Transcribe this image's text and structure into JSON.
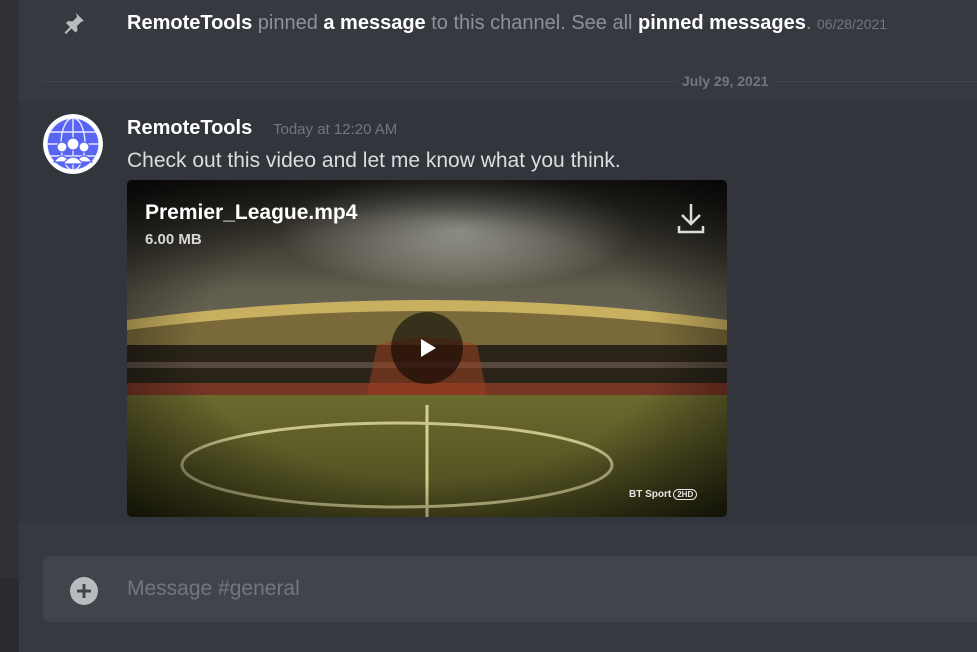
{
  "pinned_notice": {
    "user": "RemoteTools",
    "text_1": " pinned ",
    "link_1": "a message",
    "text_2": " to this channel. See all ",
    "link_2": "pinned messages",
    "text_3": ".",
    "date": "06/28/2021",
    "icon": "pin-icon"
  },
  "divider": {
    "label": "July 29, 2021"
  },
  "message": {
    "author": "RemoteTools",
    "timestamp": "Today at 12:20 AM",
    "content": "Check out this video and let me know what you think.",
    "avatar_icon": "globe-people-avatar"
  },
  "attachment": {
    "file_name": "Premier_League.mp4",
    "file_size": "6.00 MB",
    "download_icon": "download-icon",
    "play_icon": "play-icon",
    "watermark": "BT Sport",
    "watermark_badge": "2HD"
  },
  "composer": {
    "placeholder": "Message #general",
    "value": "",
    "attach_icon": "plus-circle-icon"
  },
  "colors": {
    "background": "#36393f",
    "message_hover": "#32353b",
    "composer_bg": "#40444b",
    "text_normal": "#dcddde",
    "text_muted": "#72767d",
    "avatar_accent": "#5865f2"
  }
}
